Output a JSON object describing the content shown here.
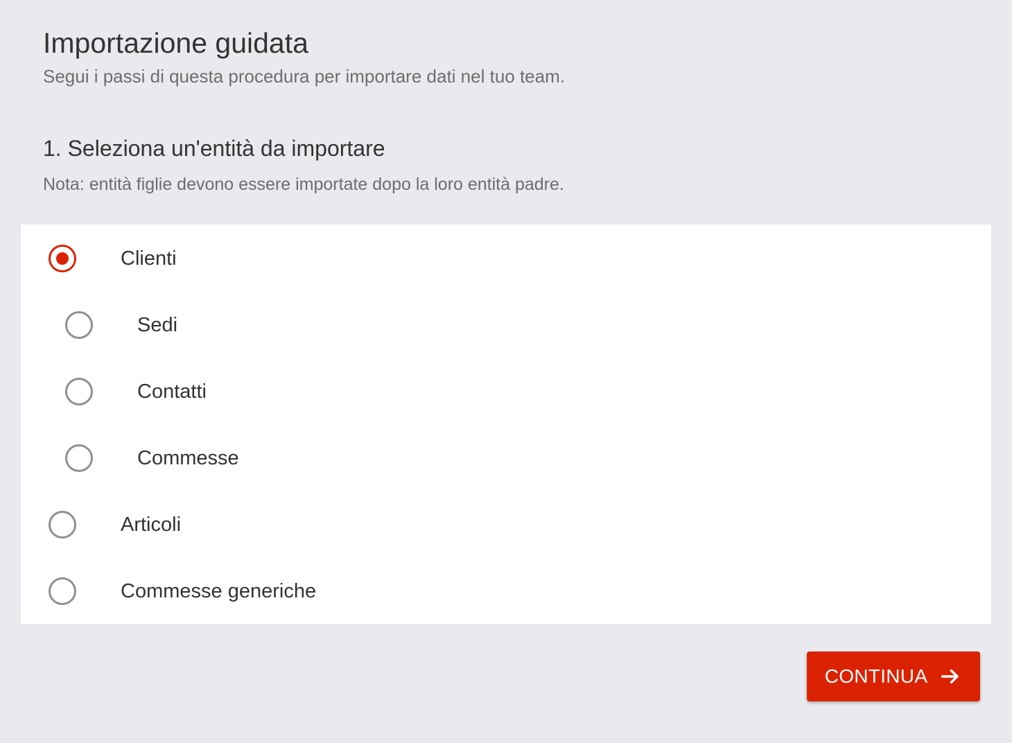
{
  "header": {
    "title": "Importazione guidata",
    "subtitle": "Segui i passi di questa procedura per importare dati nel tuo team."
  },
  "step": {
    "title": "1. Seleziona un'entità da importare",
    "note": "Nota: entità figlie devono essere importate dopo la loro entità padre."
  },
  "options": [
    {
      "label": "Clienti",
      "level": 0,
      "selected": true
    },
    {
      "label": "Sedi",
      "level": 1,
      "selected": false
    },
    {
      "label": "Contatti",
      "level": 1,
      "selected": false
    },
    {
      "label": "Commesse",
      "level": 1,
      "selected": false
    },
    {
      "label": "Articoli",
      "level": 0,
      "selected": false
    },
    {
      "label": "Commesse generiche",
      "level": 0,
      "selected": false
    }
  ],
  "actions": {
    "continue_label": "CONTINUA",
    "continue_icon": "arrow-right-icon"
  },
  "colors": {
    "accent": "#db2200",
    "background": "#e9eaee",
    "panel": "#ffffff",
    "text": "#333333",
    "muted_text": "#6d6d6d",
    "radio_border": "#8f8f8f"
  }
}
